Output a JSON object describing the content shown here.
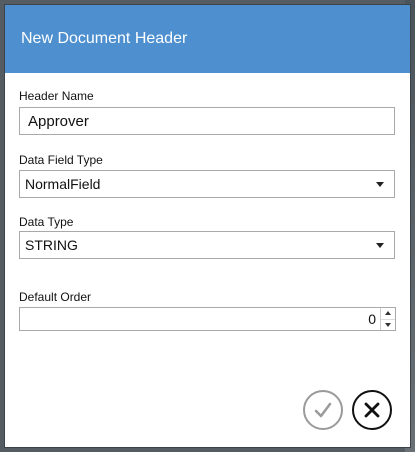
{
  "dialog": {
    "title": "New Document Header",
    "accent_color": "#4d8fcf"
  },
  "form": {
    "header_name": {
      "label": "Header Name",
      "value": "Approver"
    },
    "data_field_type": {
      "label": "Data Field Type",
      "selected": "NormalField"
    },
    "data_type": {
      "label": "Data Type",
      "selected": "STRING"
    },
    "default_order": {
      "label": "Default Order",
      "value": "0"
    }
  },
  "actions": {
    "confirm_icon": "check-icon",
    "cancel_icon": "close-icon",
    "confirm_color": "#9a9a9a",
    "cancel_color": "#111111"
  }
}
